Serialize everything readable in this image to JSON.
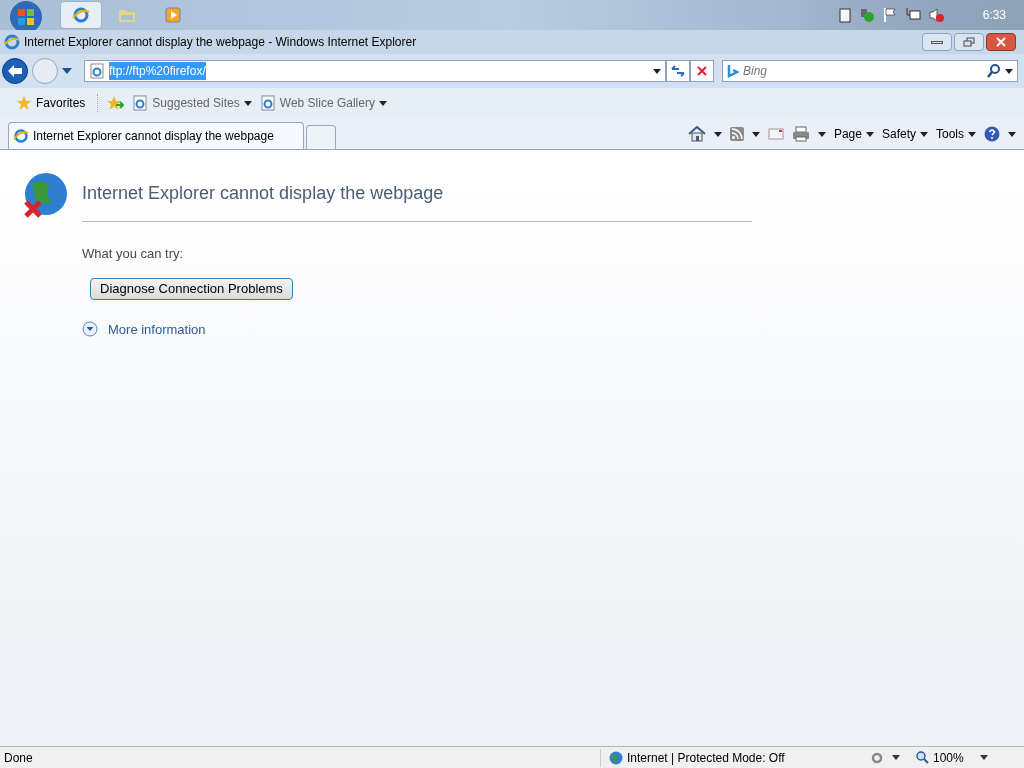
{
  "taskbar": {
    "buttons": [
      {
        "kind": "browser",
        "selected": true
      },
      {
        "kind": "folder",
        "selected": false
      },
      {
        "kind": "media",
        "selected": false
      }
    ],
    "clock": "6:33"
  },
  "window": {
    "title": "Internet Explorer cannot display the webpage - Windows Internet Explorer"
  },
  "address_bar": {
    "value": "ftp://ftp%20firefox/",
    "selected": true
  },
  "search": {
    "placeholder": "Bing"
  },
  "favorites_bar": {
    "favorites": "Favorites",
    "links": [
      "Suggested Sites",
      "Web Slice Gallery"
    ]
  },
  "tabs": [
    {
      "label": "Internet Explorer cannot display the webpage",
      "selected": true
    }
  ],
  "command_bar": [
    "Page",
    "Safety",
    "Tools"
  ],
  "page": {
    "heading": "Internet Explorer cannot display the webpage",
    "prompt": "What you can try:",
    "button": "Diagnose Connection Problems",
    "more_info": "More information"
  },
  "status_bar": {
    "text": "Done",
    "zone": "Internet | Protected Mode: Off",
    "zoom": "100%"
  }
}
